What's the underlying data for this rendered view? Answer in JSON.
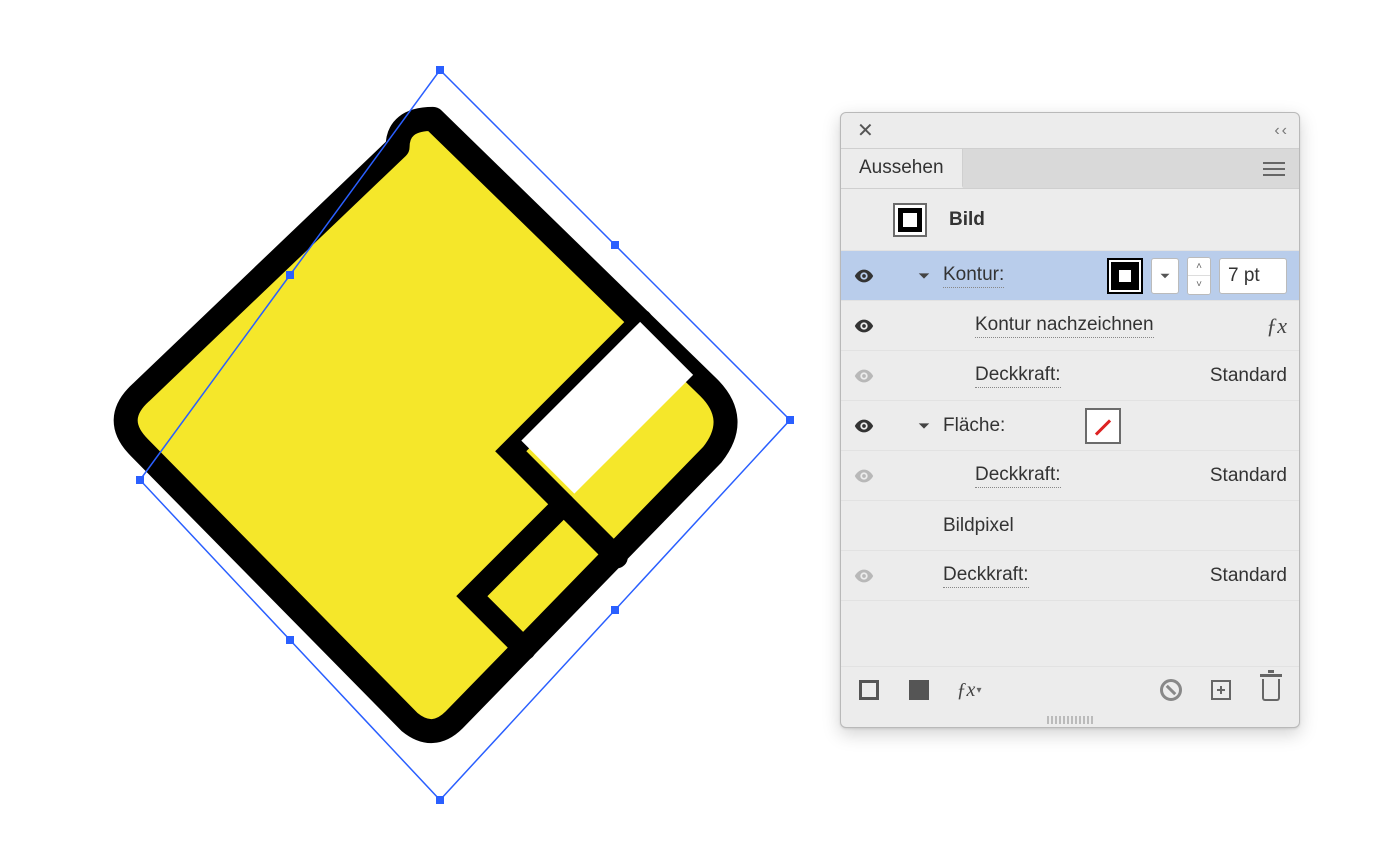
{
  "panel": {
    "title_tab": "Aussehen",
    "header_label": "Bild",
    "rows": {
      "kontur": {
        "label": "Kontur:",
        "weight_value": "7 pt"
      },
      "kontur_redraw": {
        "label": "Kontur nachzeichnen",
        "fx": "ƒx"
      },
      "kontur_opacity": {
        "label": "Deckkraft:",
        "value": "Standard"
      },
      "flaeche": {
        "label": "Fläche:"
      },
      "flaeche_opacity": {
        "label": "Deckkraft:",
        "value": "Standard"
      },
      "bildpixel": {
        "label": "Bildpixel"
      },
      "overall_opacity": {
        "label": "Deckkraft:",
        "value": "Standard"
      }
    },
    "footer": {
      "fx": "ƒx"
    }
  },
  "colors": {
    "shape_fill": "#f5e72a",
    "selection_blue": "#2a5fff"
  }
}
